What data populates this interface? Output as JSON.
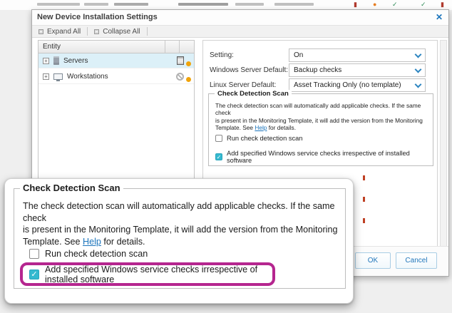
{
  "icons": {
    "close": "✕",
    "check": "✓",
    "expand_plus": "+"
  },
  "dialog": {
    "title": "New Device Installation Settings",
    "toolbar": {
      "expand_all": "Expand All",
      "collapse_all": "Collapse All"
    },
    "tree": {
      "header": "Entity",
      "items": [
        {
          "label": "Servers",
          "selected": true
        },
        {
          "label": "Workstations",
          "selected": false
        }
      ]
    },
    "settings": [
      {
        "label": "Setting:",
        "value": "On"
      },
      {
        "label": "Windows Server Default:",
        "value": "Backup checks"
      },
      {
        "label": "Linux Server Default:",
        "value": "Asset Tracking Only (no template)"
      }
    ],
    "footer": {
      "ok": "OK",
      "cancel": "Cancel"
    }
  },
  "check_detection": {
    "title": "Check Detection Scan",
    "line1": "The check detection scan will automatically add applicable checks. If the same check",
    "line2": "is present in the Monitoring Template, it will add the version from the Monitoring",
    "line3_prefix": "Template. See ",
    "help_link": "Help",
    "line3_suffix": " for details.",
    "run_scan_label": "Run check detection scan",
    "run_scan_checked": false,
    "add_checks_label": "Add specified Windows service checks irrespective of installed software",
    "add_checks_checked": true
  },
  "colors": {
    "highlight_magenta": "#b5268f",
    "checkbox_checked_fill": "#35b9cf",
    "link_blue": "#1c75bc",
    "selected_row_blue": "#dcf0f8",
    "status_dot_orange": "#f0a30a"
  }
}
